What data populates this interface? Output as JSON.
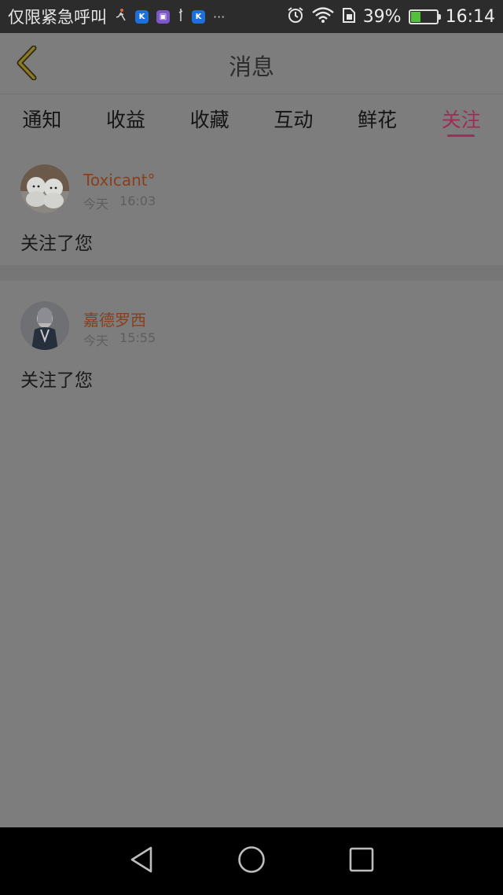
{
  "status_bar": {
    "carrier_text": "仅限紧急呼叫",
    "more_indicator": "···",
    "battery_percent": "39%",
    "battery_level": 0.39,
    "time": "16:14",
    "icons": [
      "runner-icon",
      "k-app-icon",
      "photo-app-icon",
      "tall-figure-icon",
      "k-app-icon",
      "alarm-icon",
      "wifi-icon",
      "sim-icon",
      "battery-icon"
    ]
  },
  "header": {
    "title": "消息",
    "back_icon": "chevron-left-icon"
  },
  "tabs": [
    {
      "label": "通知",
      "active": false
    },
    {
      "label": "收益",
      "active": false
    },
    {
      "label": "收藏",
      "active": false
    },
    {
      "label": "互动",
      "active": false
    },
    {
      "label": "鲜花",
      "active": false
    },
    {
      "label": "关注",
      "active": true
    }
  ],
  "messages": [
    {
      "username": "Toxicant°",
      "day": "今天",
      "time": "16:03",
      "text": "关注了您"
    },
    {
      "username": "嘉德罗西",
      "day": "今天",
      "time": "15:55",
      "text": "关注了您"
    }
  ],
  "colors": {
    "accent": "#9c2e57",
    "username": "#8a3f1c",
    "overlay_bg": "#7d7d7d"
  },
  "nav": {
    "back_icon": "triangle-back-icon",
    "home_icon": "circle-home-icon",
    "recents_icon": "square-recents-icon"
  }
}
